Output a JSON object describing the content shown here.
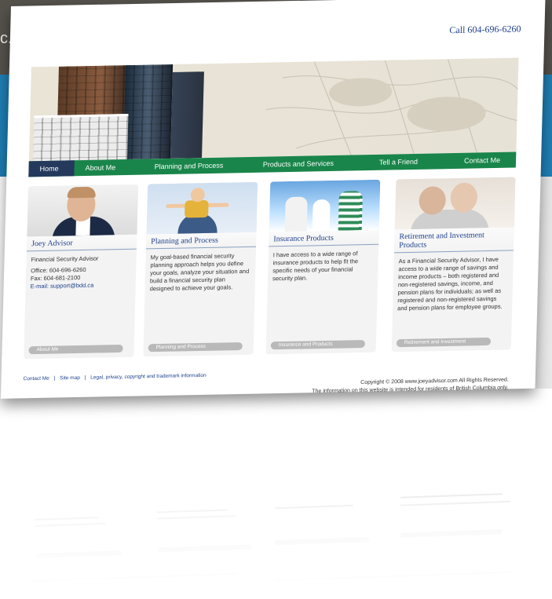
{
  "backdrop": {
    "corner_text": "c."
  },
  "site": {
    "phone": "Call 604-696-6260",
    "nav": [
      "Home",
      "About Me",
      "Planning and Process",
      "Products and Services",
      "Tell a Friend",
      "Contact Me"
    ],
    "cards": [
      {
        "title": "Joey Advisor",
        "lines": [
          "Financial Security Advisor",
          "Office: 604-696-6260",
          "Fax: 604-681-2100",
          "E-mail: support@bdd.ca"
        ],
        "more": "About Me"
      },
      {
        "title": "Planning and Process",
        "body": "My goal-based financial security planning approach helps you define your goals, analyze your situation and build a financial security plan designed to achieve your goals.",
        "more": "Planning and Process"
      },
      {
        "title": "Insurance Products",
        "body": "I have access to a wide range of insurance products to help fit the specific needs of your financial security plan.",
        "more": "Insurance and Products"
      },
      {
        "title": "Retirement and Investment Products",
        "body": "As a Financial Security Advisor, I have access to a wide range of savings and income products – both registered and non-registered savings, income, and pension plans for individuals; as well as registered and non-registered savings and pension plans for employee groups.",
        "more": "Retirement and Investment"
      }
    ],
    "footer": {
      "links": [
        "Contact Me",
        "|",
        "Site map",
        "|",
        "Legal, privacy, copyright and trademark information"
      ],
      "copyright": "Copyright © 2008 www.joeyadvisor.com All Rights Reserved.",
      "notice": "The information on this website is intended for residents of British Columbia only."
    }
  }
}
